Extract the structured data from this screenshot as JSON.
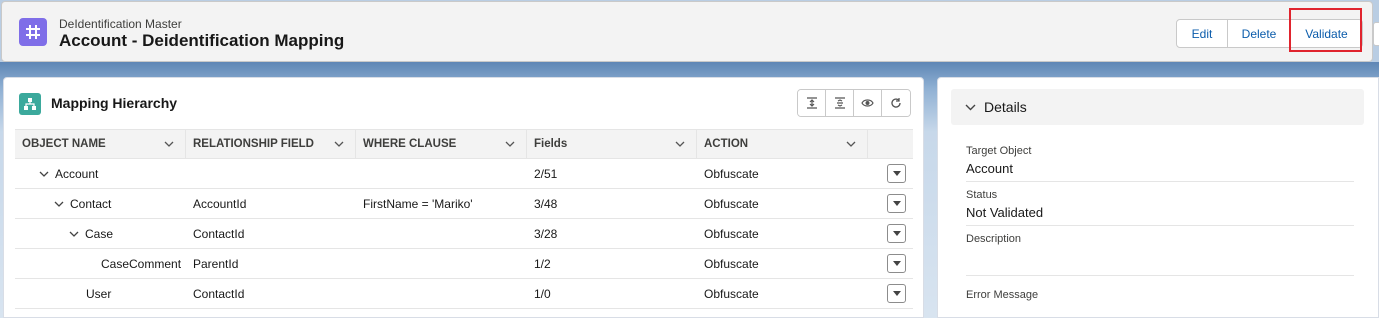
{
  "header": {
    "subtitle": "DeIdentification Master",
    "title": "Account - Deidentification Mapping",
    "icon": "hash-grid-icon",
    "actions": {
      "edit": "Edit",
      "delete": "Delete",
      "validate": "Validate"
    }
  },
  "hierarchy": {
    "title": "Mapping Hierarchy",
    "toolbar": [
      "expand-all-icon",
      "collapse-all-icon",
      "preview-eye-icon",
      "refresh-icon"
    ],
    "columns": [
      "OBJECT NAME",
      "RELATIONSHIP FIELD",
      "WHERE CLAUSE",
      "Fields",
      "ACTION"
    ],
    "rows": [
      {
        "object": "Account",
        "relationship": "",
        "where": "",
        "fields": "2/51",
        "action": "Obfuscate"
      },
      {
        "object": "Contact",
        "relationship": "AccountId",
        "where": "FirstName = 'Mariko'",
        "fields": "3/48",
        "action": "Obfuscate"
      },
      {
        "object": "Case",
        "relationship": "ContactId",
        "where": "",
        "fields": "3/28",
        "action": "Obfuscate"
      },
      {
        "object": "CaseComment",
        "relationship": "ParentId",
        "where": "",
        "fields": "1/2",
        "action": "Obfuscate"
      },
      {
        "object": "User",
        "relationship": "ContactId",
        "where": "",
        "fields": "1/0",
        "action": "Obfuscate"
      }
    ]
  },
  "details": {
    "title": "Details",
    "target_object_label": "Target Object",
    "target_object_value": "Account",
    "status_label": "Status",
    "status_value": "Not Validated",
    "description_label": "Description",
    "description_value": "",
    "error_label": "Error Message"
  },
  "colors": {
    "accent": "#0b5cab",
    "object_icon": "#7f6ee8",
    "hierarchy_icon": "#3ba99c",
    "highlight": "#e0242e"
  }
}
